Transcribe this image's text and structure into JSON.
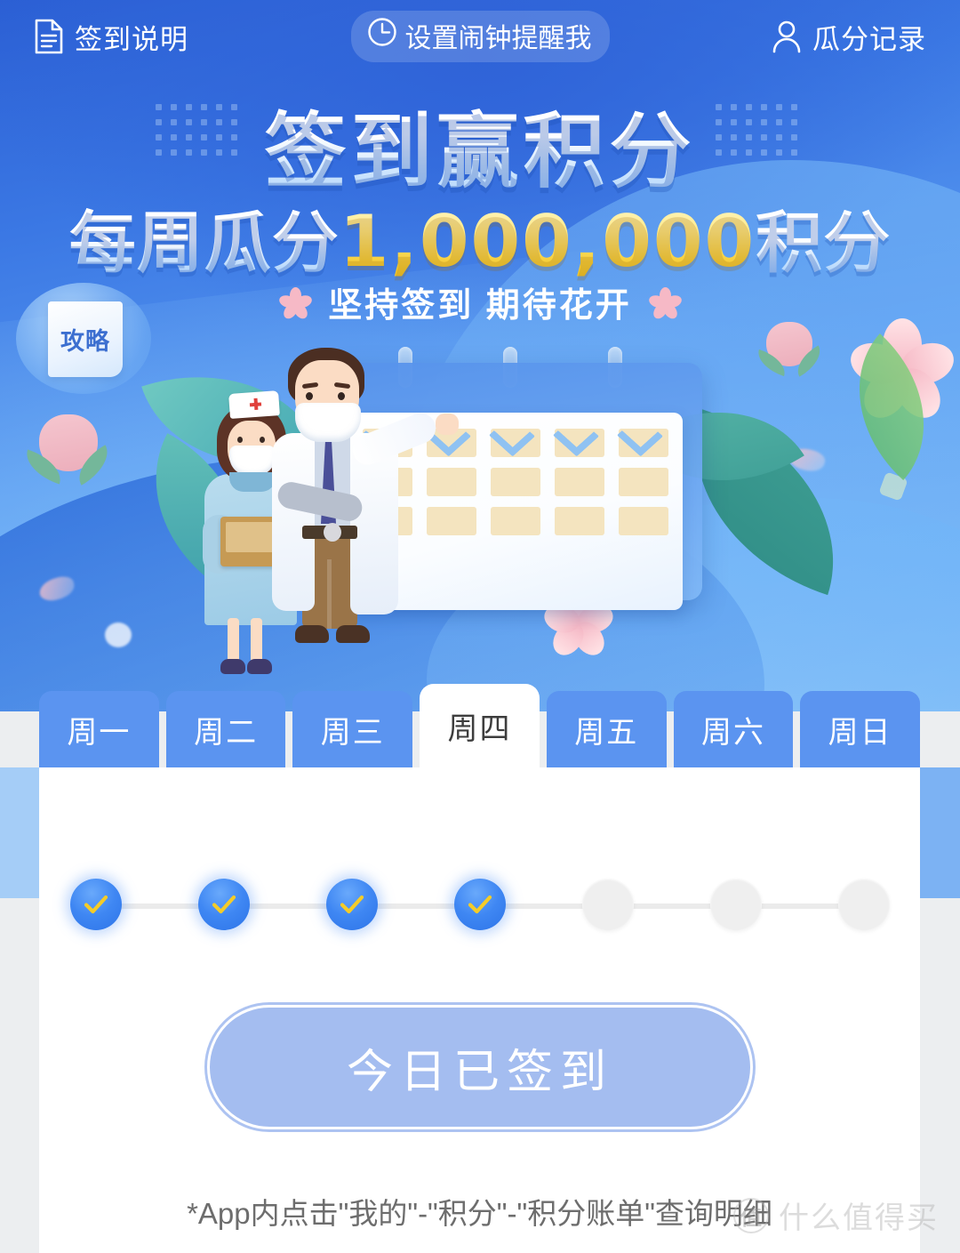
{
  "header": {
    "left_label": "签到说明",
    "left_icon": "document-icon",
    "center_label": "设置闹钟提醒我",
    "center_icon": "clock-icon",
    "right_label": "瓜分记录",
    "right_icon": "person-icon"
  },
  "banner": {
    "title": "签到赢积分",
    "subtitle_prefix": "每周瓜分",
    "subtitle_number": "1,000,000",
    "subtitle_suffix": "积分",
    "slogan": "坚持签到 期待花开",
    "guide_badge": "攻略",
    "colors": {
      "banner_blue": "#3b78e4",
      "gold": "#f6cf3c",
      "tab_blue": "#5b94f0",
      "check_blue": "#3f87f3",
      "check_gold": "#f5cc28",
      "button_fill": "#a4bdf0"
    }
  },
  "calendar_illustration": {
    "rows": 3,
    "cols": 5,
    "checked_row_index": 0
  },
  "tabs": [
    {
      "label": "周一",
      "active": false
    },
    {
      "label": "周二",
      "active": false
    },
    {
      "label": "周三",
      "active": false
    },
    {
      "label": "周四",
      "active": true
    },
    {
      "label": "周五",
      "active": false
    },
    {
      "label": "周六",
      "active": false
    },
    {
      "label": "周日",
      "active": false
    }
  ],
  "progress": {
    "total_steps": 7,
    "completed_steps": 4,
    "steps": [
      {
        "state": "done"
      },
      {
        "state": "done"
      },
      {
        "state": "done"
      },
      {
        "state": "done"
      },
      {
        "state": "todo"
      },
      {
        "state": "todo"
      },
      {
        "state": "todo"
      }
    ]
  },
  "sign_button": {
    "label": "今日已签到",
    "enabled": false
  },
  "footnote": "*App内点击\"我的\"-\"积分\"-\"积分账单\"查询明细",
  "watermark": {
    "logo_text": "值",
    "text": "什么值得买"
  }
}
